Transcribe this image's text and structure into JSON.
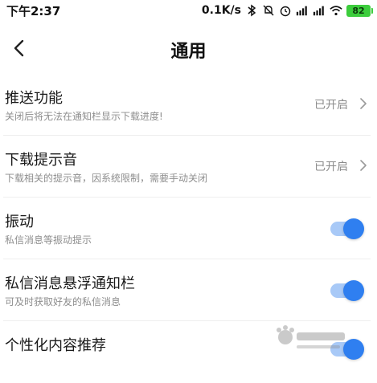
{
  "status_bar": {
    "time": "下午2:37",
    "net_speed": "0.1K/s",
    "battery": "82",
    "icons": [
      "bluetooth-icon",
      "mute-icon",
      "alarm-icon",
      "hd-signal-icon",
      "signal-icon",
      "wifi-icon",
      "battery-icon"
    ]
  },
  "header": {
    "title": "通用",
    "back_icon": "chevron-left-icon"
  },
  "settings": [
    {
      "title": "推送功能",
      "description": "关闭后将无法在通知栏显示下载进度!",
      "control": "link",
      "status": "已开启"
    },
    {
      "title": "下载提示音",
      "description": "下载相关的提示音，因系统限制，需要手动关闭",
      "control": "link",
      "status": "已开启"
    },
    {
      "title": "振动",
      "description": "私信消息等振动提示",
      "control": "toggle",
      "enabled": true
    },
    {
      "title": "私信消息悬浮通知栏",
      "description": "可及时获取好友的私信消息",
      "control": "toggle",
      "enabled": true
    },
    {
      "title": "个性化内容推荐",
      "description": "",
      "control": "toggle",
      "enabled": true
    }
  ],
  "colors": {
    "accent": "#2f7ff0",
    "toggle_track": "#a8c9f7",
    "battery": "#3ccd3c"
  }
}
